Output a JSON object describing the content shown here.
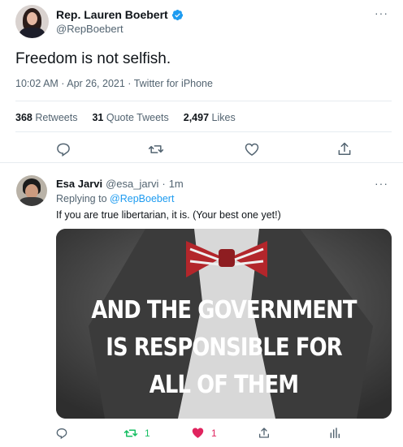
{
  "main_tweet": {
    "display_name": "Rep. Lauren Boebert",
    "handle": "@RepBoebert",
    "text": "Freedom is not selfish.",
    "meta": "10:02 AM · Apr 26, 2021 · Twitter for iPhone",
    "stats": [
      {
        "count": "368",
        "label": "Retweets"
      },
      {
        "count": "31",
        "label": "Quote Tweets"
      },
      {
        "count": "2,497",
        "label": "Likes"
      }
    ],
    "more_glyph": "···"
  },
  "reply": {
    "display_name": "Esa Jarvi",
    "handle": "@esa_jarvi",
    "separator": "·",
    "time": "1m",
    "replying_prefix": "Replying to",
    "replying_to": "@RepBoebert",
    "text": "If you are true libertarian, it is. (Your best one yet!)",
    "meme_lines": [
      "AND THE GOVERNMENT",
      "IS RESPONSIBLE FOR",
      "ALL OF THEM"
    ],
    "retweet_count": "1",
    "like_count": "1",
    "more_glyph": "···"
  },
  "colors": {
    "accent": "#1d9bf0",
    "retweet_active": "#17bf63",
    "like_active": "#e0245e",
    "secondary_text": "#536471"
  },
  "icons": [
    "verified-badge-icon",
    "reply-icon",
    "retweet-icon",
    "like-icon",
    "share-icon",
    "analytics-icon",
    "more-icon"
  ]
}
